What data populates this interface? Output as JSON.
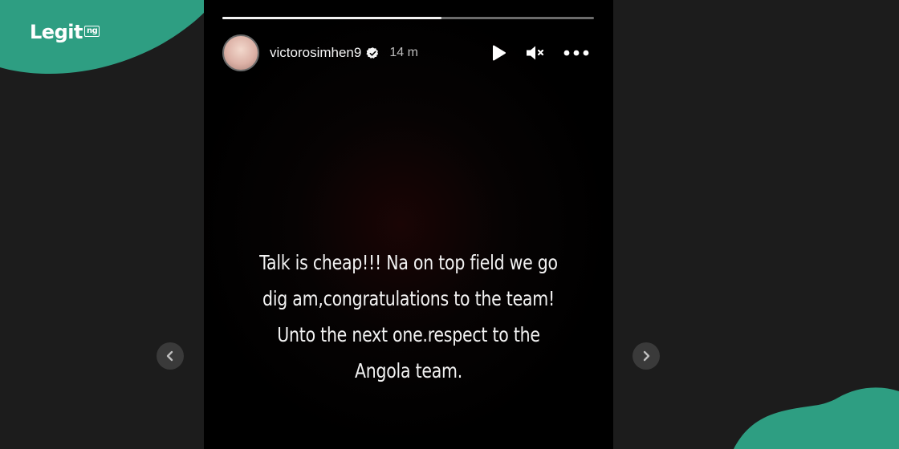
{
  "logo": {
    "brand": "Legit",
    "suffix": "ng"
  },
  "colors": {
    "brand_teal": "#2e9e82",
    "background": "#1c1c1c",
    "story_bg": "#000000"
  },
  "story": {
    "progress": 0.59,
    "username": "victorosimhen9",
    "verified": true,
    "time_ago": "14 m",
    "text_lines": [
      "Talk is cheap!!! Na on top  field we go",
      "dig am,congratulations to the team!",
      "Unto the next one.respect to the",
      "Angola team."
    ]
  },
  "icons": {
    "play": "play-icon",
    "mute": "speaker-muted-icon",
    "more": "more-options-icon",
    "prev": "chevron-left-icon",
    "next": "chevron-right-icon"
  }
}
